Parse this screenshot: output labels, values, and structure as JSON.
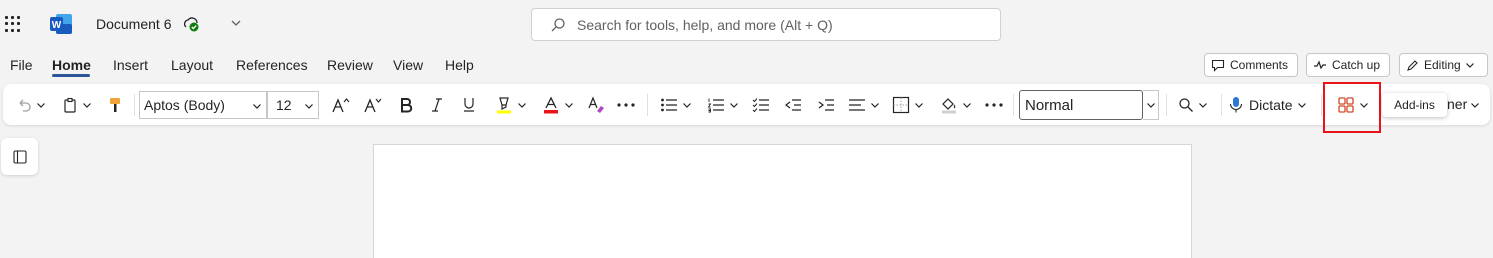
{
  "title_bar": {
    "document_title": "Document 6",
    "search_placeholder": "Search for tools, help, and more (Alt + Q)",
    "app_logo_letter": "W"
  },
  "menu": {
    "tabs": [
      "File",
      "Home",
      "Insert",
      "Layout",
      "References",
      "Review",
      "View",
      "Help"
    ],
    "active_tab": "Home",
    "comments_label": "Comments",
    "catchup_label": "Catch up",
    "editing_label": "Editing"
  },
  "ribbon": {
    "font_name": "Aptos (Body)",
    "font_size": "12",
    "style_name": "Normal",
    "dictate_label": "Dictate",
    "addins_tooltip": "Add-ins",
    "partial_label": "ner",
    "icons": [
      "undo-icon",
      "paste-icon",
      "format-painter-icon",
      "grow-font-icon",
      "shrink-font-icon",
      "bold-icon",
      "italic-icon",
      "underline-icon",
      "highlight-icon",
      "font-color-icon",
      "clear-formatting-icon",
      "more-icon",
      "bullets-icon",
      "numbering-icon",
      "checklist-icon",
      "decrease-indent-icon",
      "increase-indent-icon",
      "align-icon",
      "borders-icon",
      "shading-icon",
      "find-icon",
      "microphone-icon",
      "add-ins-icon"
    ]
  },
  "colors": {
    "accent": "#2b579a",
    "font_color_bar": "#e8141a",
    "highlight_bar": "#ffff00",
    "addins_icon": "#d24726",
    "red_box": "#e8141a",
    "sync_ok": "#107c10"
  }
}
